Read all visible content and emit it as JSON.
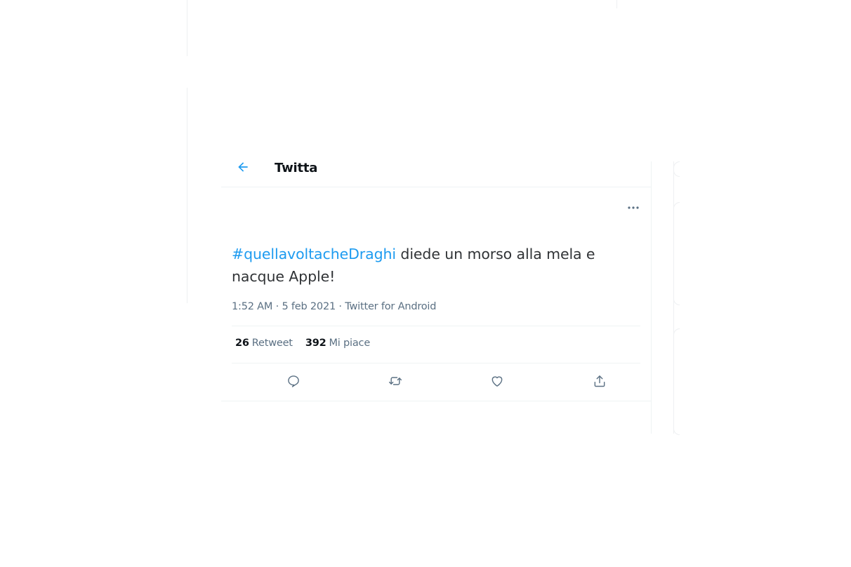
{
  "header": {
    "title": "Twitta"
  },
  "tweet": {
    "hashtag": "#quellavoltacheDraghi",
    "text": " diede un morso alla mela e nacque Apple!",
    "time": "1:52 AM",
    "separator": " · ",
    "date": "5 feb 2021",
    "source": "Twitter for Android"
  },
  "stats": {
    "retweets_count": "26",
    "retweets_label": "Retweet",
    "likes_count": "392",
    "likes_label": "Mi piace"
  },
  "colors": {
    "accent": "#1d9bf0",
    "text": "#303336",
    "secondary": "#5b7083",
    "border": "#eff3f4"
  },
  "icons": {
    "back": "arrow-left-icon",
    "more": "more-horizontal-icon",
    "reply": "reply-icon",
    "retweet": "retweet-icon",
    "like": "heart-icon",
    "share": "share-icon"
  }
}
